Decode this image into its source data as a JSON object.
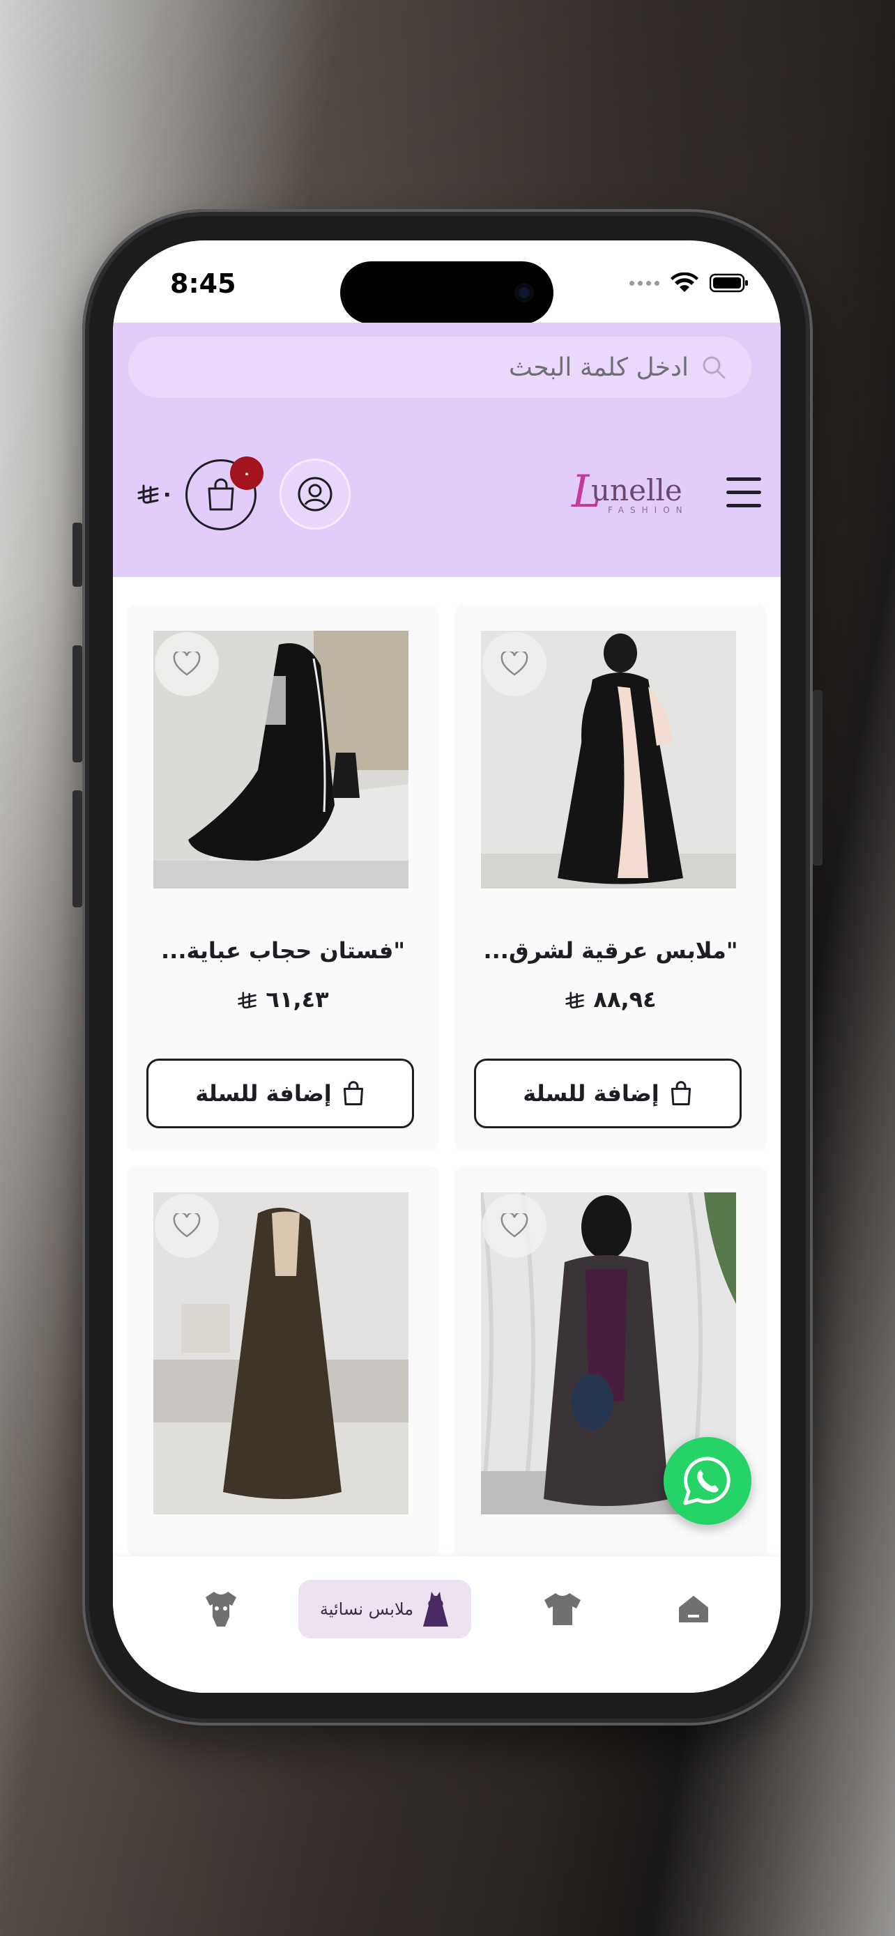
{
  "status_bar": {
    "time": "8:45"
  },
  "search": {
    "placeholder": "ادخل كلمة البحث"
  },
  "header": {
    "logo_text": "unelle",
    "logo_initial": "L",
    "logo_sub": "FASHION",
    "cart_badge": "٠",
    "cart_total": "٠"
  },
  "products": [
    {
      "title": "\"ملابس عرقية لشرق...",
      "price": "٨٨,٩٤",
      "add_label": "إضافة للسلة"
    },
    {
      "title": "\"فستان حجاب عباية...",
      "price": "٦١,٤٣",
      "add_label": "إضافة للسلة"
    },
    {
      "title": "",
      "price": "",
      "add_label": ""
    },
    {
      "title": "",
      "price": "",
      "add_label": ""
    }
  ],
  "bottom_nav": {
    "items": [
      {
        "icon": "home-icon"
      },
      {
        "icon": "shirt-icon"
      },
      {
        "icon": "dress-icon",
        "label": "ملابس نسائية",
        "active": true
      },
      {
        "icon": "baby-onesie-icon"
      }
    ]
  },
  "colors": {
    "header_bg": "#e2cdfa",
    "badge": "#a4141e",
    "whatsapp": "#26d367"
  }
}
